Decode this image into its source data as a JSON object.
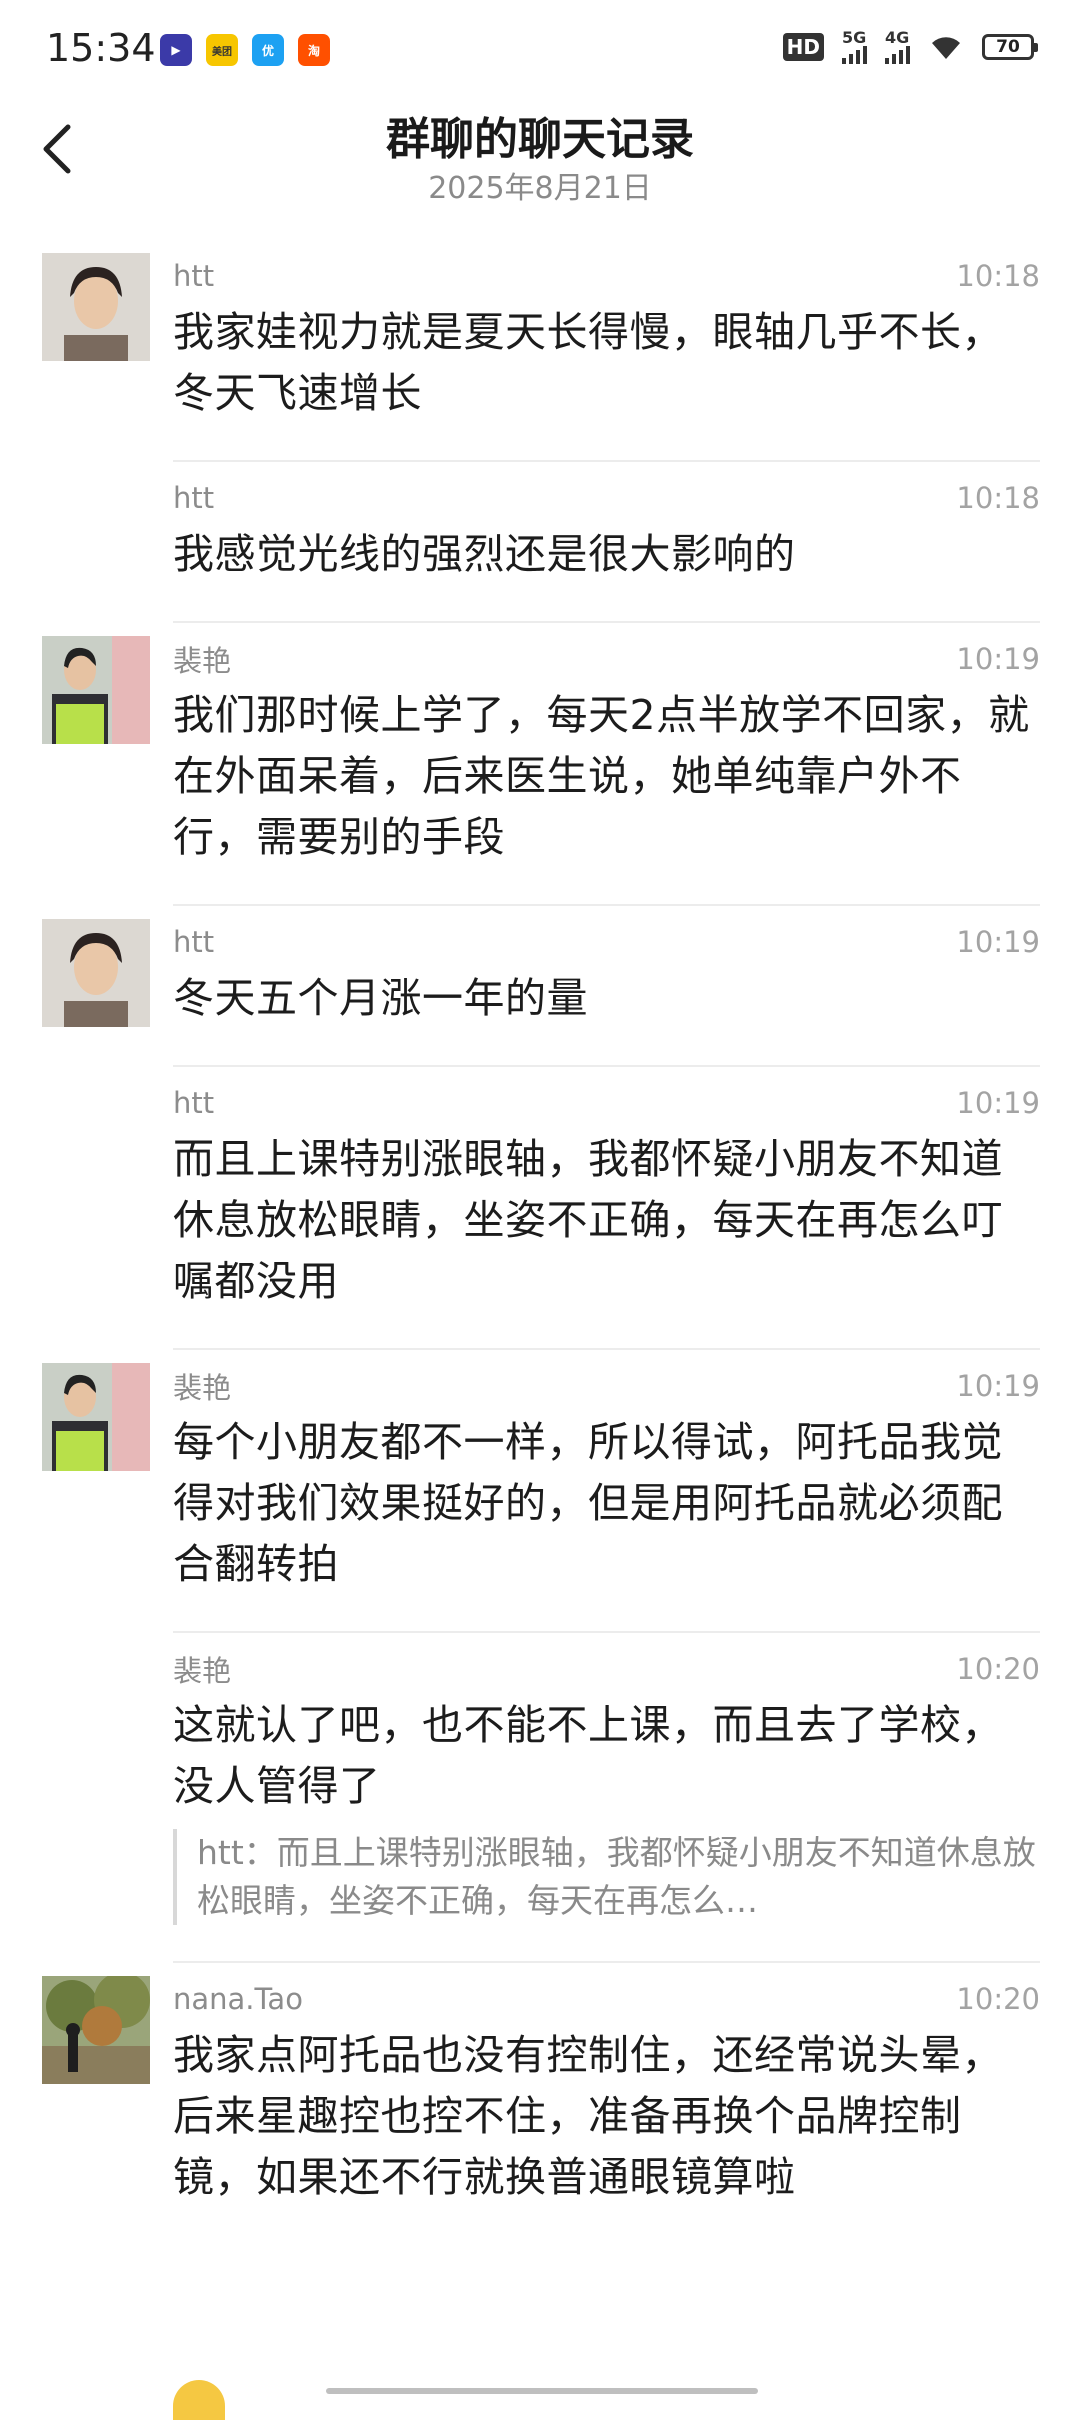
{
  "status_bar": {
    "time": "15:34",
    "app_icons": [
      {
        "name": "player",
        "color": "#3b3aa8",
        "glyph": "▶"
      },
      {
        "name": "meituan",
        "color": "#f7c600",
        "glyph": "美团"
      },
      {
        "name": "fruit",
        "color": "#1da1f2",
        "glyph": "优"
      },
      {
        "name": "taobao",
        "color": "#ff5000",
        "glyph": "淘"
      }
    ],
    "hd": "HD",
    "signal_5g": "5G",
    "signal_4g": "4G",
    "battery": "70"
  },
  "header": {
    "title": "群聊的聊天记录",
    "subtitle": "2025年8月21日"
  },
  "messages": [
    {
      "sender": "htt",
      "time": "10:18",
      "text": "我家娃视力就是夏天长得慢，眼轴几乎不长，冬天飞速增长",
      "avatar": "htt"
    },
    {
      "sender": "htt",
      "time": "10:18",
      "text": "我感觉光线的强烈还是很大影响的",
      "avatar": ""
    },
    {
      "sender": "裴艳",
      "time": "10:19",
      "text": "我们那时候上学了，每天2点半放学不回家，就在外面呆着，后来医生说，她单纯靠户外不行，需要别的手段",
      "avatar": "peiyan"
    },
    {
      "sender": "htt",
      "time": "10:19",
      "text": "冬天五个月涨一年的量",
      "avatar": "htt"
    },
    {
      "sender": "htt",
      "time": "10:19",
      "text": "而且上课特别涨眼轴，我都怀疑小朋友不知道休息放松眼睛，坐姿不正确，每天在再怎么叮嘱都没用",
      "avatar": ""
    },
    {
      "sender": "裴艳",
      "time": "10:19",
      "text": "每个小朋友都不一样，所以得试，阿托品我觉得对我们效果挺好的，但是用阿托品就必须配合翻转拍",
      "avatar": "peiyan"
    },
    {
      "sender": "裴艳",
      "time": "10:20",
      "text": "这就认了吧，也不能不上课，而且去了学校，没人管得了",
      "avatar": "",
      "quote": "htt：而且上课特别涨眼轴，我都怀疑小朋友不知道休息放松眼睛，坐姿不正确，每天在再怎么…"
    },
    {
      "sender": "nana.Tao",
      "time": "10:20",
      "text": "我家点阿托品也没有控制住，还经常说头晕，后来星趣控也控不住，准备再换个品牌控制镜，如果还不行就换普通眼镜算啦",
      "avatar": "nana"
    }
  ]
}
